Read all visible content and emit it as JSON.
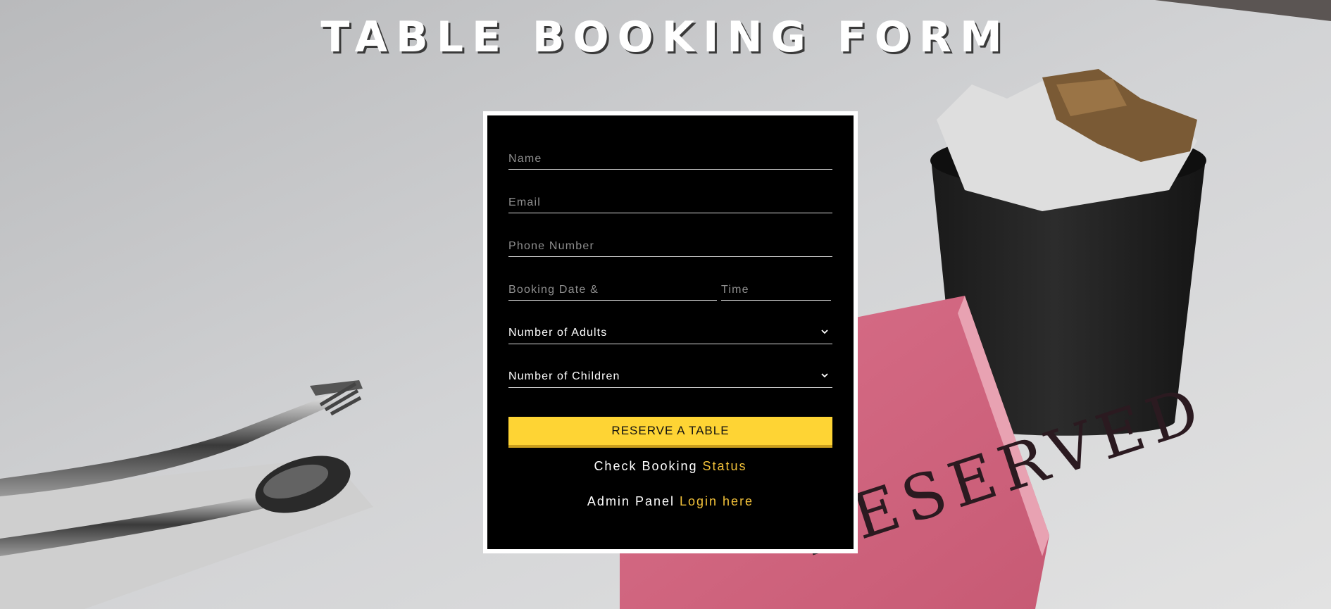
{
  "page": {
    "title": "TABLE BOOKING FORM"
  },
  "form": {
    "name_placeholder": "Name",
    "email_placeholder": "Email",
    "phone_placeholder": "Phone Number",
    "date_placeholder": "Booking Date &",
    "time_placeholder": "Time",
    "adults_select": "Number of Adults",
    "children_select": "Number of Children",
    "reserve_label": "RESERVE A TABLE"
  },
  "links": {
    "check_prefix": "Check Booking",
    "check_link": "Status",
    "admin_prefix": "Admin Panel",
    "admin_link": "Login here"
  },
  "background_sign_text": "RESERVED",
  "icons": {
    "select_chevron": "chevron-down-icon"
  },
  "colors": {
    "accent": "#fed434",
    "link": "#f3c23a",
    "card_bg": "#000000",
    "card_border": "#ffffff"
  }
}
